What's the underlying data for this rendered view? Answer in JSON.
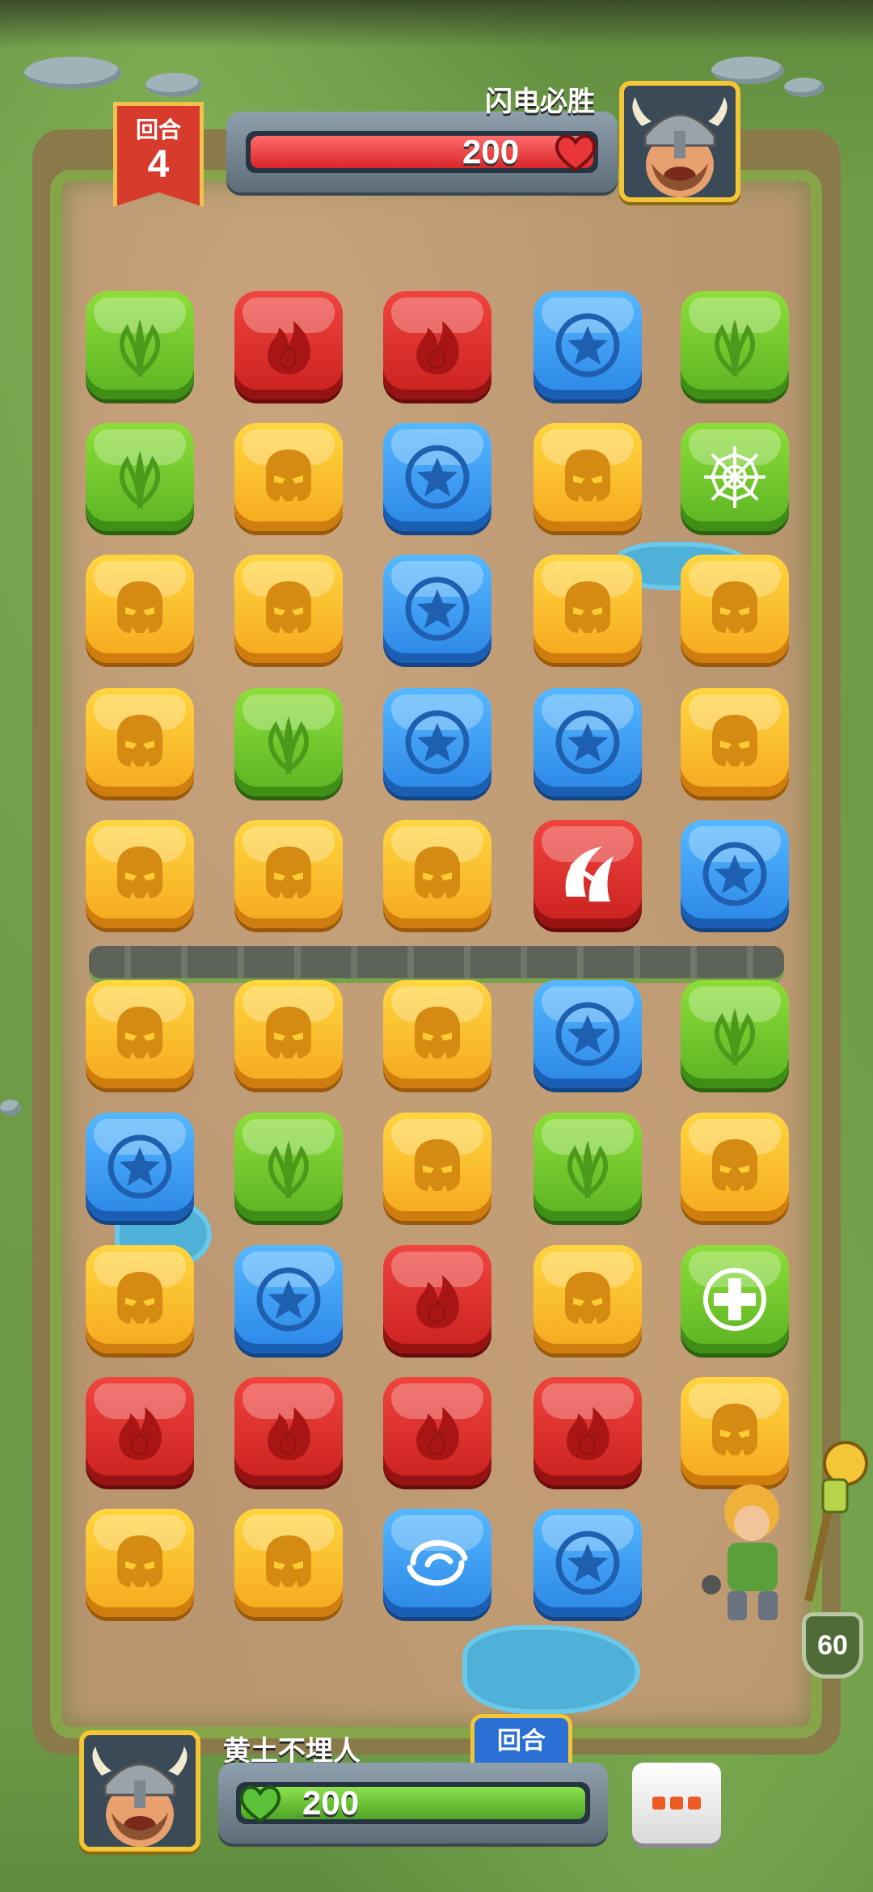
{
  "hud": {
    "round_label": "回合",
    "round_number": "4",
    "opponent_name": "闪电必胜",
    "opponent_hp": "200",
    "opponent_hp_fraction": 1.0,
    "player_name": "黄土不埋人",
    "player_hp": "200",
    "player_hp_fraction": 1.0,
    "turn_tab_label": "回合",
    "hero_level": "60"
  },
  "colors": {
    "green": "#6cc52b",
    "red": "#d92b28",
    "blue": "#3a97f0",
    "yellow": "#f8bb2a",
    "enemy_hp": "#e8363a",
    "player_hp": "#6ec336"
  },
  "board": {
    "rows": [
      [
        {
          "color": "green",
          "icon": "leaf-icon"
        },
        {
          "color": "red",
          "icon": "fire-icon"
        },
        {
          "color": "red",
          "icon": "fire-icon"
        },
        {
          "color": "blue",
          "icon": "star-icon"
        },
        {
          "color": "green",
          "icon": "leaf-icon"
        }
      ],
      [
        {
          "color": "green",
          "icon": "leaf-icon"
        },
        {
          "color": "yellow",
          "icon": "skull-icon"
        },
        {
          "color": "blue",
          "icon": "star-icon"
        },
        {
          "color": "yellow",
          "icon": "skull-icon"
        },
        {
          "color": "green",
          "icon": "spiderweb-icon"
        }
      ],
      [
        {
          "color": "yellow",
          "icon": "skull-icon"
        },
        {
          "color": "yellow",
          "icon": "skull-icon"
        },
        {
          "color": "blue",
          "icon": "star-icon"
        },
        {
          "color": "yellow",
          "icon": "skull-icon"
        },
        {
          "color": "yellow",
          "icon": "skull-icon"
        }
      ],
      [
        {
          "color": "yellow",
          "icon": "skull-icon"
        },
        {
          "color": "green",
          "icon": "leaf-icon"
        },
        {
          "color": "blue",
          "icon": "star-icon"
        },
        {
          "color": "blue",
          "icon": "star-icon"
        },
        {
          "color": "yellow",
          "icon": "skull-icon"
        }
      ],
      [
        {
          "color": "yellow",
          "icon": "skull-icon"
        },
        {
          "color": "yellow",
          "icon": "skull-icon"
        },
        {
          "color": "yellow",
          "icon": "skull-icon"
        },
        {
          "color": "red",
          "icon": "slash-icon"
        },
        {
          "color": "blue",
          "icon": "star-icon"
        }
      ],
      [
        {
          "color": "yellow",
          "icon": "skull-icon"
        },
        {
          "color": "yellow",
          "icon": "skull-icon"
        },
        {
          "color": "yellow",
          "icon": "skull-icon"
        },
        {
          "color": "blue",
          "icon": "star-icon"
        },
        {
          "color": "green",
          "icon": "leaf-icon"
        }
      ],
      [
        {
          "color": "blue",
          "icon": "star-icon"
        },
        {
          "color": "green",
          "icon": "leaf-icon"
        },
        {
          "color": "yellow",
          "icon": "skull-icon"
        },
        {
          "color": "green",
          "icon": "leaf-icon"
        },
        {
          "color": "yellow",
          "icon": "skull-icon"
        }
      ],
      [
        {
          "color": "yellow",
          "icon": "skull-icon"
        },
        {
          "color": "blue",
          "icon": "star-icon"
        },
        {
          "color": "red",
          "icon": "fire-icon"
        },
        {
          "color": "yellow",
          "icon": "skull-icon"
        },
        {
          "color": "green",
          "icon": "heal-cross-icon"
        }
      ],
      [
        {
          "color": "red",
          "icon": "fire-icon"
        },
        {
          "color": "red",
          "icon": "fire-icon"
        },
        {
          "color": "red",
          "icon": "fire-icon"
        },
        {
          "color": "red",
          "icon": "fire-icon"
        },
        {
          "color": "yellow",
          "icon": "skull-icon"
        }
      ],
      [
        {
          "color": "yellow",
          "icon": "skull-icon"
        },
        {
          "color": "yellow",
          "icon": "skull-icon"
        },
        {
          "color": "blue",
          "icon": "whirlwind-icon"
        },
        {
          "color": "blue",
          "icon": "star-icon"
        },
        null
      ]
    ]
  }
}
